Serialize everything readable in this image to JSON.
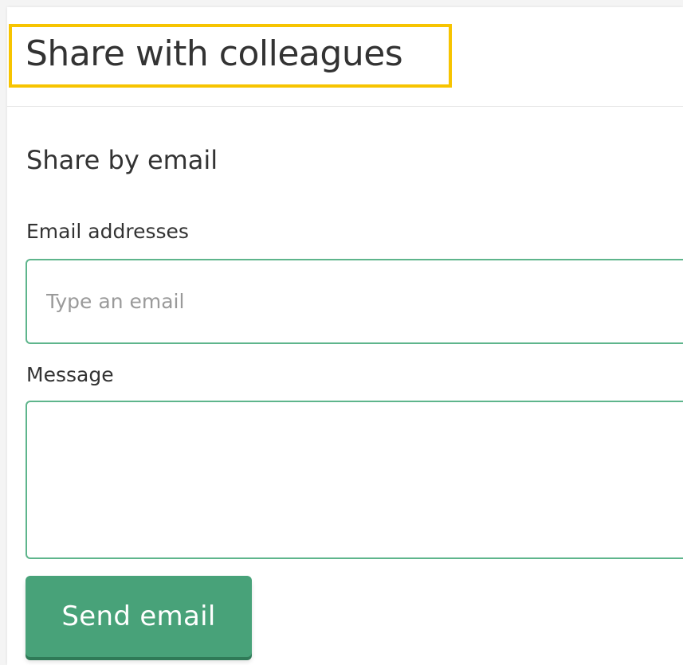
{
  "header": {
    "title": "Share with colleagues",
    "highlight_color": "#f7c400"
  },
  "share_by_email": {
    "section_title": "Share by email",
    "email_label": "Email addresses",
    "email_placeholder": "Type an email",
    "email_value": "",
    "message_label": "Message",
    "message_value": "",
    "send_label": "Send email"
  },
  "colors": {
    "accent": "#48a279",
    "input_border": "#5eb58c",
    "text": "#333333"
  }
}
